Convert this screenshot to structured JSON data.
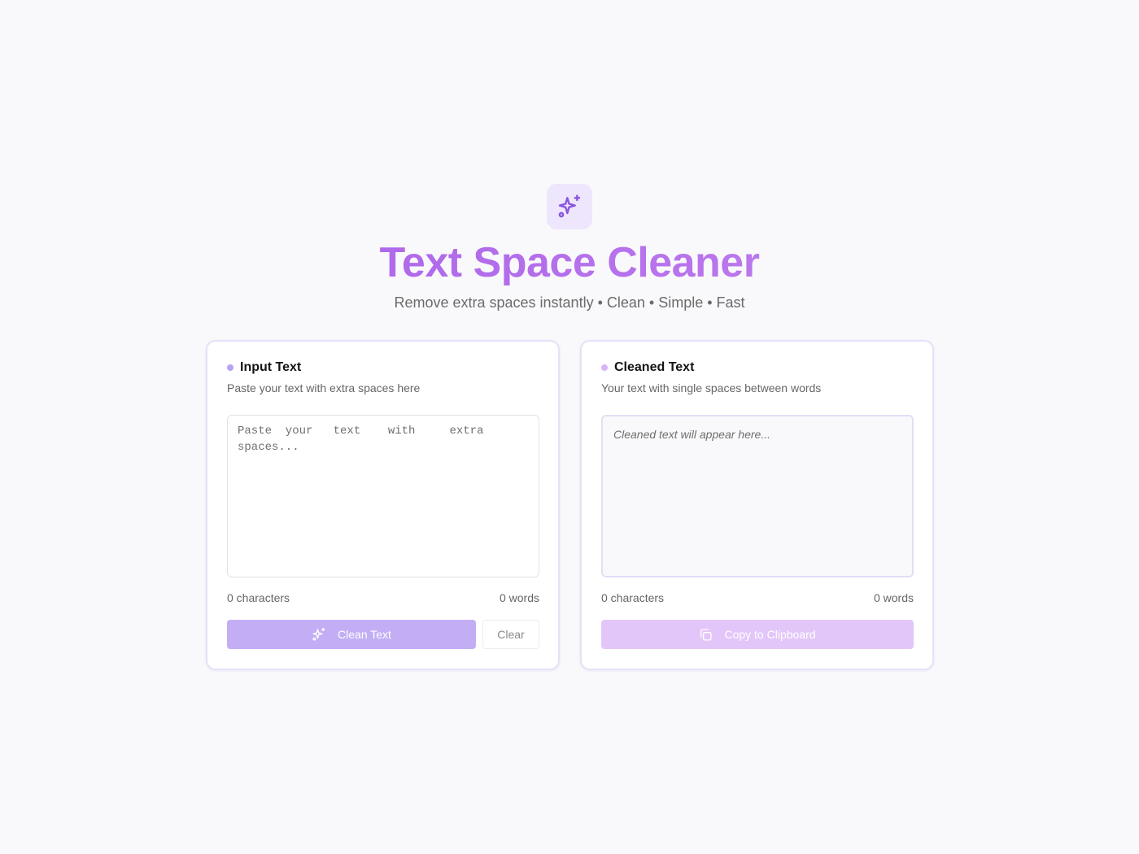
{
  "header": {
    "title": "Text Space Cleaner",
    "subtitle": "Remove extra spaces instantly • Clean • Simple • Fast",
    "logo_icon": "sparkles-icon"
  },
  "input_panel": {
    "title": "Input Text",
    "description": "Paste your text with extra spaces here",
    "placeholder": "Paste  your   text    with     extra spaces...",
    "value": "",
    "characters_label": "0 characters",
    "words_label": "0 words",
    "clean_button_label": "Clean Text",
    "clean_button_icon": "sparkles-icon",
    "clear_button_label": "Clear"
  },
  "output_panel": {
    "title": "Cleaned Text",
    "description": "Your text with single spaces between words",
    "placeholder": "Cleaned text will appear here...",
    "characters_label": "0 characters",
    "words_label": "0 words",
    "copy_button_label": "Copy to Clipboard",
    "copy_button_icon": "copy-icon"
  },
  "colors": {
    "accent": "#a45de8",
    "clean_button": "#c3aef6",
    "copy_button": "#e3c6f9",
    "background": "#f9f9fb"
  }
}
